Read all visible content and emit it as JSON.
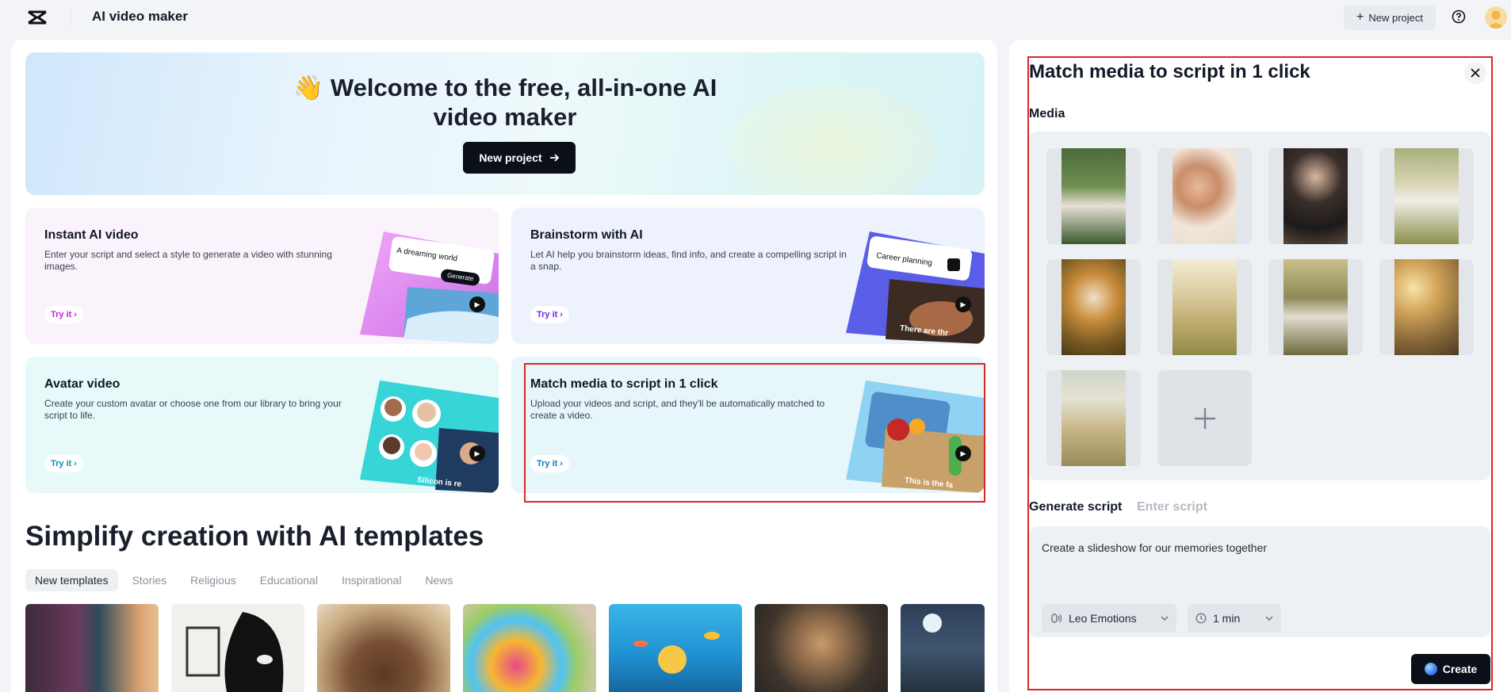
{
  "header": {
    "app_title": "AI video maker",
    "new_project_label": "New project"
  },
  "hero": {
    "emoji": "👋",
    "title": "Welcome to the free, all-in-one AI video maker",
    "button_label": "New project"
  },
  "cards": [
    {
      "title": "Instant AI video",
      "desc": "Enter your script and select a style to generate a video with stunning images.",
      "try": "Try it",
      "accent": "#c026d3",
      "art_text": "A dreaming world",
      "art_button": "Generate"
    },
    {
      "title": "Brainstorm with AI",
      "desc": "Let AI help you brainstorm ideas, find info, and create a compelling script in a snap.",
      "try": "Try it",
      "accent": "#6d28d9",
      "art_text": "Career planning",
      "art_caption": "There are thr"
    },
    {
      "title": "Avatar video",
      "desc": "Create your custom avatar or choose one from our library to bring your script to life.",
      "try": "Try it",
      "accent": "#0891b2",
      "art_caption": "Silicon is re"
    },
    {
      "title": "Match media to script in 1 click",
      "desc": "Upload your videos and script, and they'll be automatically matched to create a video.",
      "try": "Try it",
      "accent": "#0284c7",
      "art_caption": "This is the fa"
    }
  ],
  "templates": {
    "section_title": "Simplify creation with AI templates",
    "tabs": [
      "New templates",
      "Stories",
      "Religious",
      "Educational",
      "Inspirational",
      "News"
    ],
    "active_tab": 0
  },
  "side_panel": {
    "title": "Match media to script in 1 click",
    "media_label": "Media",
    "media_count": 9,
    "script_tabs": {
      "generate": "Generate script",
      "enter": "Enter script"
    },
    "script_text": "Create a slideshow for our memories together",
    "voice": "Leo Emotions",
    "duration": "1 min",
    "create_label": "Create"
  },
  "colors": {
    "highlight_outline": "#dc2626",
    "primary_button": "#0b0f17"
  }
}
